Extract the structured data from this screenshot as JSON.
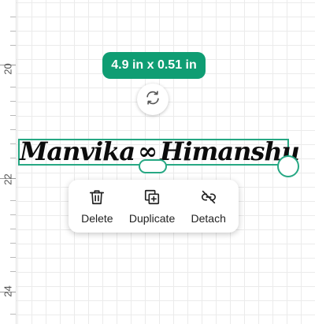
{
  "ruler": {
    "labels": [
      "20",
      "22",
      "24"
    ]
  },
  "dimension_label": "4.9 in x 0.51 in",
  "rotate_icon": "rotate-icon",
  "selected_text": {
    "part1": "Manvika",
    "symbol": "∞",
    "part2": "Himanshu"
  },
  "selection_color": "#27a884",
  "accent_color": "#0f9d73",
  "action_menu": {
    "items": [
      {
        "label": "Delete",
        "icon": "trash-icon"
      },
      {
        "label": "Duplicate",
        "icon": "duplicate-icon"
      },
      {
        "label": "Detach",
        "icon": "detach-icon"
      }
    ]
  }
}
